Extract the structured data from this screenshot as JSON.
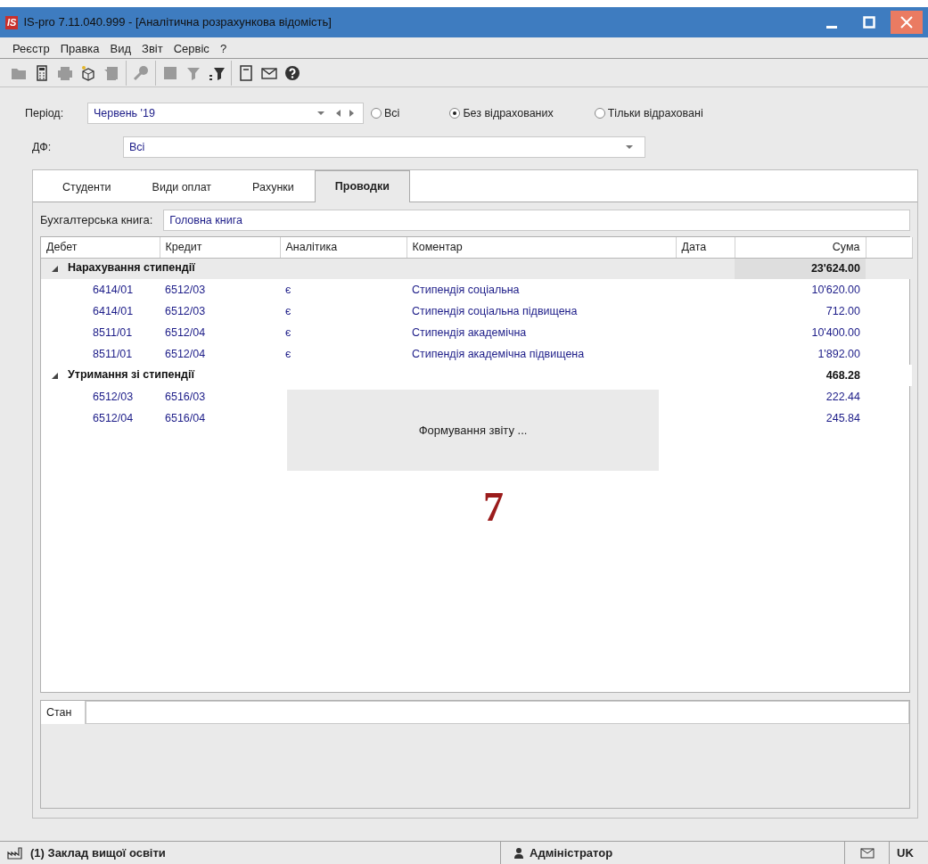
{
  "window": {
    "title": "IS-pro 7.11.040.999 - [Аналітична розрахункова відомість]",
    "logo": "IS"
  },
  "menu": [
    "Реєстр",
    "Правка",
    "Вид",
    "Звіт",
    "Сервіс",
    "?"
  ],
  "toolbar": [
    {
      "kind": "folder",
      "disabled": true
    },
    {
      "kind": "calculator",
      "disabled": false
    },
    {
      "kind": "printer",
      "disabled": true
    },
    {
      "kind": "box",
      "disabled": false
    },
    {
      "kind": "stack",
      "disabled": true
    },
    {
      "kind": "key",
      "disabled": true,
      "group_start": true
    },
    {
      "kind": "square",
      "disabled": true,
      "group_start": true
    },
    {
      "kind": "filter",
      "disabled": true
    },
    {
      "kind": "filter-clear",
      "disabled": false
    },
    {
      "kind": "form",
      "disabled": false,
      "group_start": true
    },
    {
      "kind": "mail",
      "disabled": false
    },
    {
      "kind": "help",
      "disabled": false
    }
  ],
  "period": {
    "label": "Період:",
    "value": "Червень '19"
  },
  "filter_options": [
    {
      "label": "Всі",
      "selected": false
    },
    {
      "label": "Без відрахованих",
      "selected": true
    },
    {
      "label": "Тільки відраховані",
      "selected": false
    }
  ],
  "df": {
    "label": "ДФ:",
    "value": "Всі"
  },
  "tabs": [
    {
      "label": "Студенти",
      "selected": false
    },
    {
      "label": "Види оплат",
      "selected": false
    },
    {
      "label": "Рахунки",
      "selected": false
    },
    {
      "label": "Проводки",
      "selected": true
    }
  ],
  "ledger": {
    "label": "Бухгалтерська книга:",
    "value": "Головна книга"
  },
  "table": {
    "columns": [
      "Дебет",
      "Кредит",
      "Аналітика",
      "Коментар",
      "Дата",
      "Сума"
    ],
    "groups": [
      {
        "title": "Нарахування стипендії",
        "total": "23'624.00",
        "expanded": true,
        "selected": true,
        "rows": [
          [
            "6414/01",
            "6512/03",
            "є",
            "Стипендія соціальна",
            "",
            "10'620.00"
          ],
          [
            "6414/01",
            "6512/03",
            "є",
            "Стипендія соціальна підвищена",
            "",
            "712.00"
          ],
          [
            "8511/01",
            "6512/04",
            "є",
            "Стипендія академічна",
            "",
            "10'400.00"
          ],
          [
            "8511/01",
            "6512/04",
            "є",
            "Стипендія академічна підвищена",
            "",
            "1'892.00"
          ]
        ]
      },
      {
        "title": "Утримання зі стипендії",
        "total": "468.28",
        "expanded": true,
        "selected": false,
        "rows": [
          [
            "6512/03",
            "6516/03",
            "",
            "",
            "",
            "222.44"
          ],
          [
            "6512/04",
            "6516/04",
            "",
            "",
            "",
            "245.84"
          ]
        ]
      }
    ]
  },
  "progress_message": "Формування звіту ...",
  "annotation": "7",
  "state_panel": {
    "label": "Стан"
  },
  "status_bar": {
    "organization": "(1) Заклад вищої освіти",
    "user": "Адміністратор",
    "language": "UK"
  }
}
